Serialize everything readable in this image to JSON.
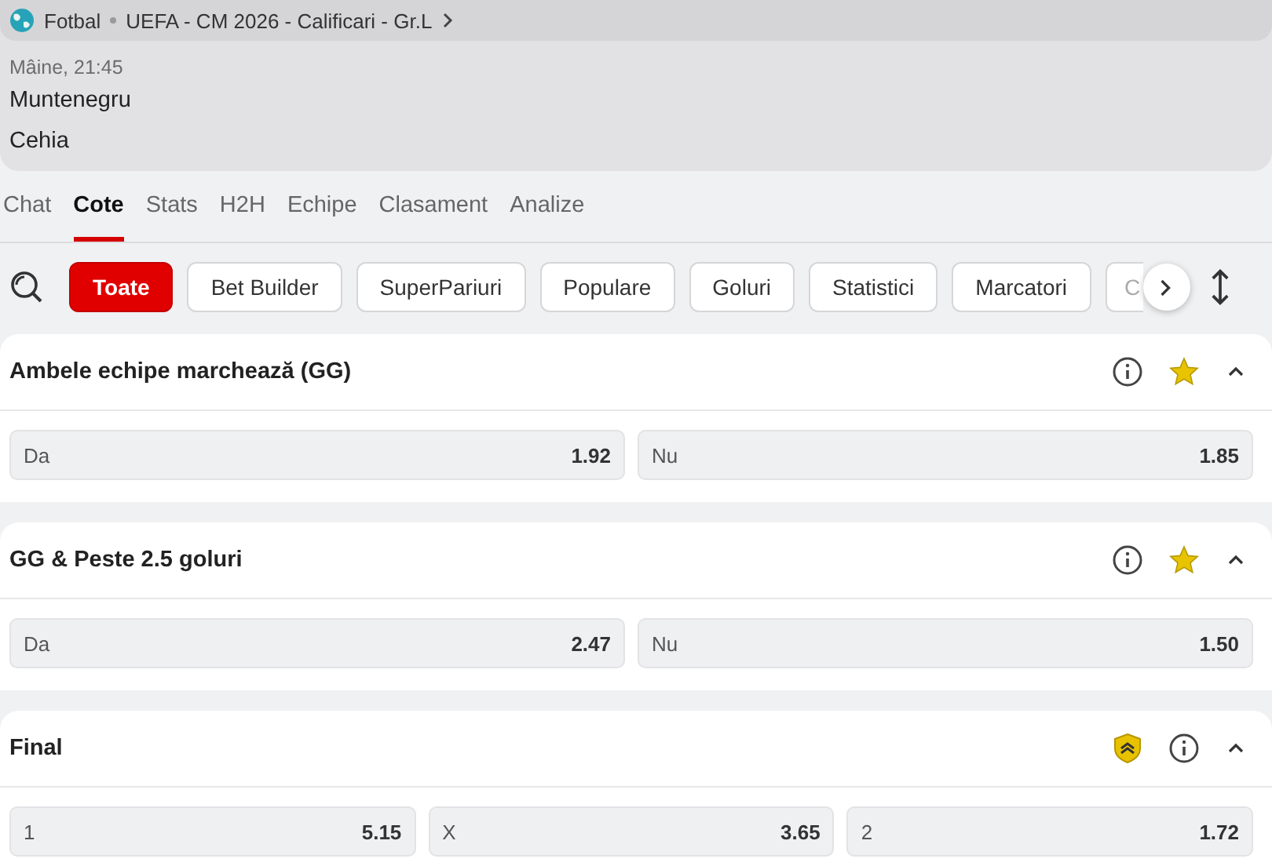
{
  "header": {
    "sport": "Fotbal",
    "competition": "UEFA - CM 2026 - Calificari - Gr.L",
    "time": "Mâine, 21:45",
    "teams": [
      "Muntenegru",
      "Cehia"
    ]
  },
  "tabs": [
    {
      "label": "Chat",
      "selected": false
    },
    {
      "label": "Cote",
      "selected": true
    },
    {
      "label": "Stats",
      "selected": false
    },
    {
      "label": "H2H",
      "selected": false
    },
    {
      "label": "Echipe",
      "selected": false
    },
    {
      "label": "Clasament",
      "selected": false
    },
    {
      "label": "Analize",
      "selected": false
    }
  ],
  "filters": [
    {
      "label": "Toate",
      "selected": true
    },
    {
      "label": "Bet Builder",
      "selected": false
    },
    {
      "label": "SuperPariuri",
      "selected": false
    },
    {
      "label": "Populare",
      "selected": false
    },
    {
      "label": "Goluri",
      "selected": false
    },
    {
      "label": "Statistici",
      "selected": false
    },
    {
      "label": "Marcatori",
      "selected": false
    },
    {
      "label": "C",
      "selected": false
    }
  ],
  "markets": [
    {
      "title": "Ambele echipe marchează (GG)",
      "favorite": true,
      "boosted": false,
      "expanded": true,
      "outcomes": [
        {
          "label": "Da",
          "odds": "1.92"
        },
        {
          "label": "Nu",
          "odds": "1.85"
        }
      ]
    },
    {
      "title": "GG & Peste 2.5 goluri",
      "favorite": true,
      "boosted": false,
      "expanded": true,
      "outcomes": [
        {
          "label": "Da",
          "odds": "2.47"
        },
        {
          "label": "Nu",
          "odds": "1.50"
        }
      ]
    },
    {
      "title": "Final",
      "favorite": false,
      "boosted": true,
      "expanded": true,
      "outcomes": [
        {
          "label": "1",
          "odds": "5.15"
        },
        {
          "label": "X",
          "odds": "3.65"
        },
        {
          "label": "2",
          "odds": "1.72"
        }
      ]
    }
  ]
}
